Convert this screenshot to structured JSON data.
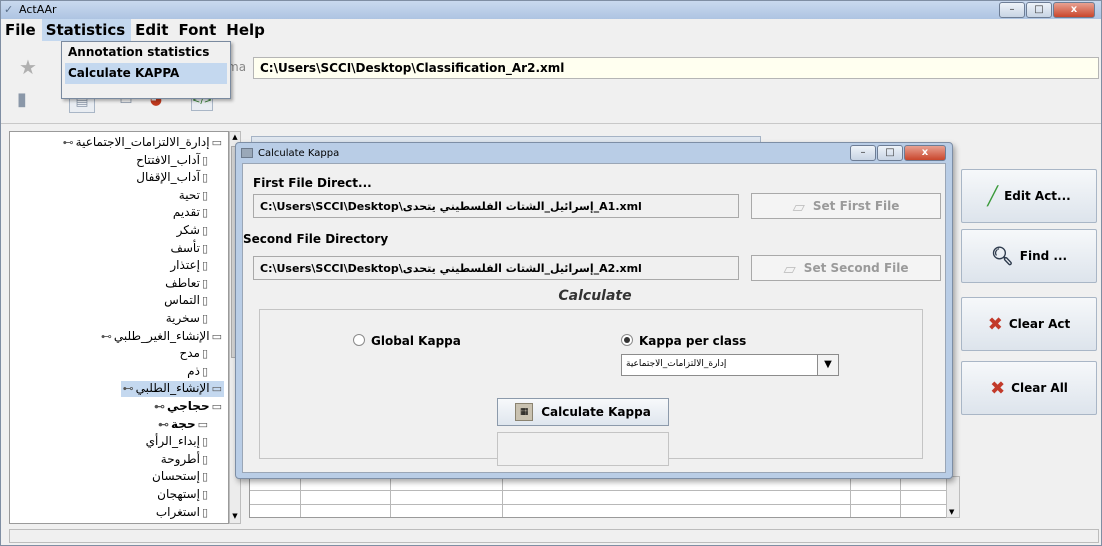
{
  "window": {
    "title": "ActAAr",
    "controls": {
      "minimize": "–",
      "maximize": "□",
      "close": "x"
    }
  },
  "menubar": {
    "items": [
      {
        "label": "File"
      },
      {
        "label": "Statistics"
      },
      {
        "label": "Edit"
      },
      {
        "label": "Font"
      },
      {
        "label": "Help"
      }
    ],
    "statistics_menu": {
      "annotation_statistics": "Annotation statistics",
      "calculate_kappa": "Calculate KAPPA"
    }
  },
  "pathbar": {
    "label_fragment": "ma",
    "path": "C:\\Users\\SCCI\\Desktop\\Classification_Ar2.xml"
  },
  "tree": {
    "nodes": [
      {
        "label": "إدارة_الالتزامات_الاجتماعية",
        "level": 0,
        "folder": true
      },
      {
        "label": "آداب_الافتتاح",
        "level": 1
      },
      {
        "label": "آداب_الإقفال",
        "level": 1
      },
      {
        "label": "تحية",
        "level": 1
      },
      {
        "label": "تقديم",
        "level": 1
      },
      {
        "label": "شكر",
        "level": 1
      },
      {
        "label": "تأسف",
        "level": 1
      },
      {
        "label": "إعتذار",
        "level": 1
      },
      {
        "label": "تعاطف",
        "level": 1
      },
      {
        "label": "التماس",
        "level": 1
      },
      {
        "label": "سخرية",
        "level": 1
      },
      {
        "label": "الإنشاء_الغير_طلبي",
        "level": 0,
        "folder": true
      },
      {
        "label": "مدح",
        "level": 1
      },
      {
        "label": "ذم",
        "level": 1
      },
      {
        "label": "الإنشاء_الطلبي",
        "level": 0,
        "folder": true,
        "selected": true
      },
      {
        "label": "حجاجي",
        "level": 0,
        "folder": true,
        "bold": true
      },
      {
        "label": "حجة",
        "level": 1,
        "folder": true,
        "bold": true
      },
      {
        "label": "إبداء_الرأي",
        "level": 1
      },
      {
        "label": "أطروحة",
        "level": 1
      },
      {
        "label": "إستحسان",
        "level": 1
      },
      {
        "label": "إستهجان",
        "level": 1
      },
      {
        "label": "استغراب",
        "level": 1
      }
    ]
  },
  "right_buttons": {
    "edit_act": "Edit Act...",
    "find": "Find ...",
    "clear_act": "Clear Act",
    "clear_all": "Clear All"
  },
  "dialog": {
    "title": "Calculate Kappa",
    "first_label": "First File Direct...",
    "first_path": "C:\\Users\\SCCI\\Desktop\\إسرائيل_الشتات الفلسطيني يتحدى_A1.xml",
    "set_first": "Set First File",
    "second_label": "Second File Directory",
    "second_path": "C:\\Users\\SCCI\\Desktop\\إسرائيل_الشتات الفلسطيني يتحدى_A2.xml",
    "set_second": "Set Second File",
    "calculate_title": "Calculate",
    "global_kappa": "Global Kappa",
    "kappa_per_class": "Kappa per class",
    "selected_mode": "kappa_per_class",
    "class_value": "إدارة_الالتزامات_الاجتماعية",
    "calculate_button": "Calculate Kappa",
    "result": ""
  },
  "colors": {
    "selection": "#c4d8ef",
    "titlebar": "#aec4e2",
    "close_button": "#c9462c"
  }
}
